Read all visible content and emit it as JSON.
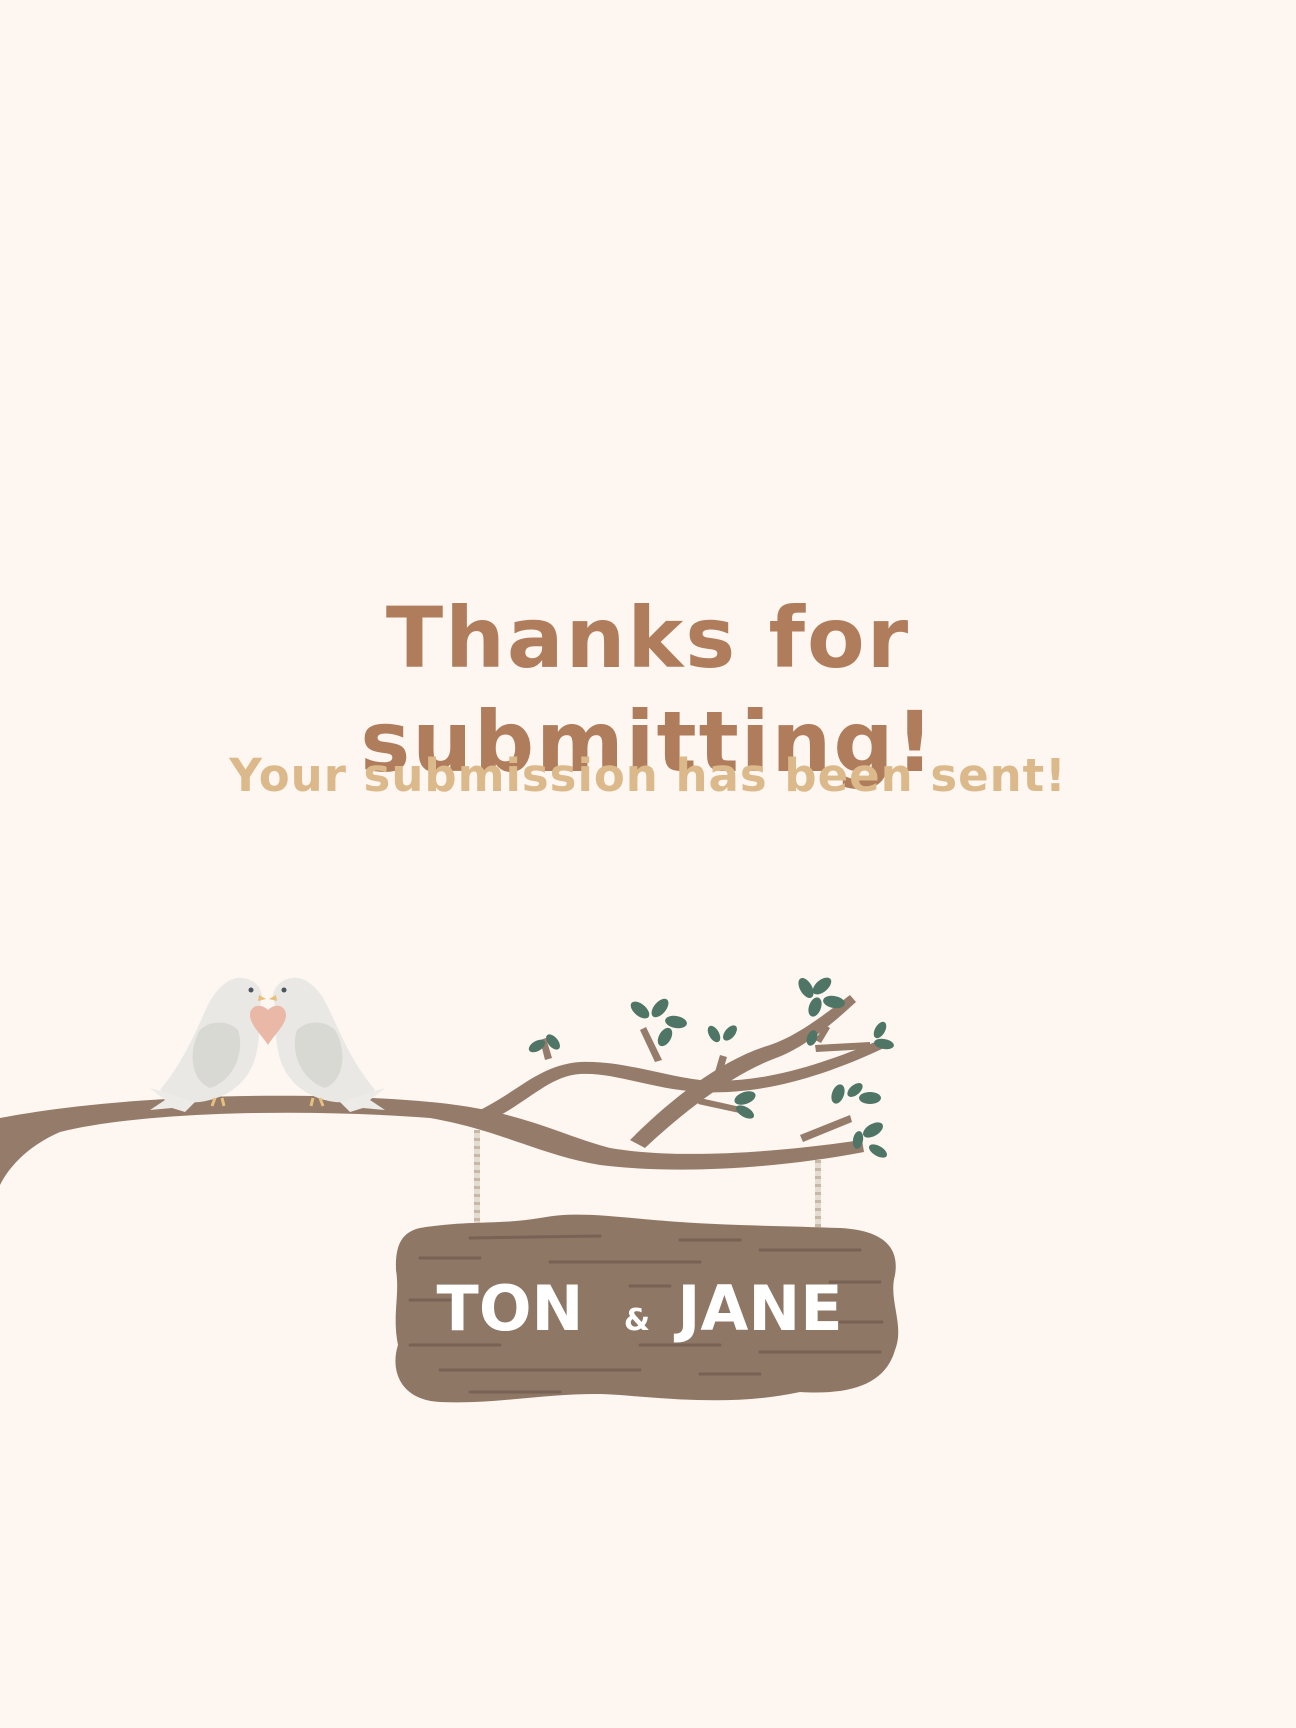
{
  "heading": {
    "line1": "Thanks for",
    "line2": "submitting!"
  },
  "subheading": "Your submission has been sent!",
  "sign": {
    "name_left": "TON",
    "ampersand": "&",
    "name_right": "JANE"
  },
  "colors": {
    "background": "#fdf6f1",
    "heading": "#b07d5c",
    "subheading": "#dcb98b",
    "branch": "#957b69",
    "sign_wood": "#8f7766",
    "leaves": "#4f7567",
    "heart": "#e9b8a6"
  },
  "icons": [
    "dove-icon",
    "heart-icon",
    "leaf-icon"
  ]
}
